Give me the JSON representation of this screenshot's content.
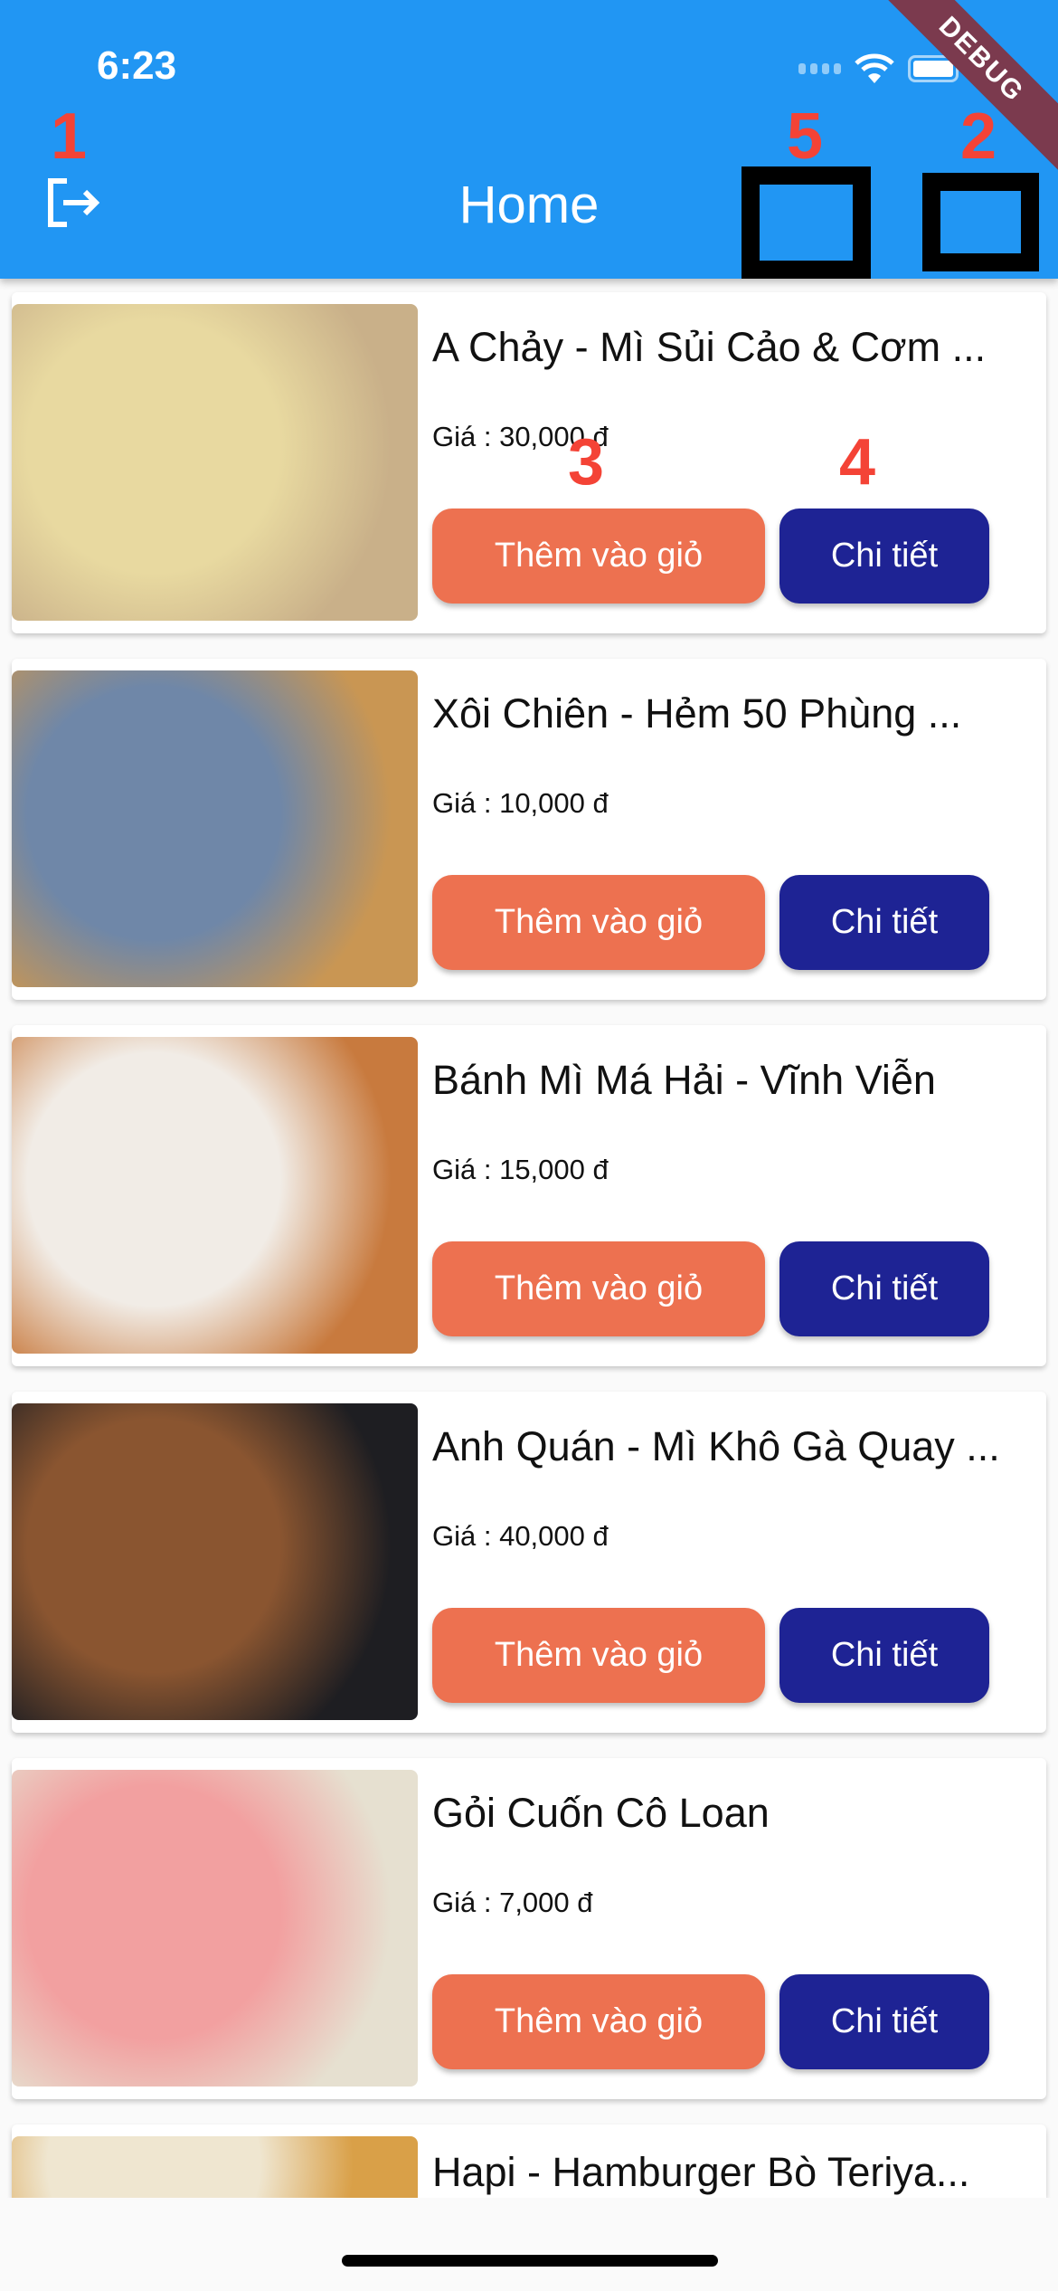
{
  "status": {
    "time": "6:23"
  },
  "appbar": {
    "title": "Home",
    "debug_banner": "DEBUG"
  },
  "annotations": [
    "1",
    "2",
    "3",
    "4",
    "5"
  ],
  "items": [
    {
      "name": "A Chảy - Mì Sủi Cảo & Cơm ...",
      "price": "Giá : 30,000 đ",
      "add_label": "Thêm vào giỏ",
      "detail_label": "Chi tiết",
      "c1": "#e8d9a0",
      "c2": "#c9b089"
    },
    {
      "name": "Xôi Chiên - Hẻm 50 Phùng ...",
      "price": "Giá : 10,000 đ",
      "add_label": "Thêm vào giỏ",
      "detail_label": "Chi tiết",
      "c1": "#6f87a8",
      "c2": "#c99653"
    },
    {
      "name": "Bánh Mì Má Hải - Vĩnh Viễn",
      "price": "Giá : 15,000 đ",
      "add_label": "Thêm vào giỏ",
      "detail_label": "Chi tiết",
      "c1": "#f1ece6",
      "c2": "#c87a3e"
    },
    {
      "name": "Anh Quán - Mì Khô Gà Quay ...",
      "price": "Giá : 40,000 đ",
      "add_label": "Thêm vào giỏ",
      "detail_label": "Chi tiết",
      "c1": "#8a5530",
      "c2": "#1e1e22"
    },
    {
      "name": "Gỏi Cuốn Cô Loan",
      "price": "Giá : 7,000 đ",
      "add_label": "Thêm vào giỏ",
      "detail_label": "Chi tiết",
      "c1": "#f2a0a0",
      "c2": "#e6e0d0"
    },
    {
      "name": "Hapi - Hamburger Bò Teriya...",
      "price": "",
      "add_label": "",
      "detail_label": "",
      "c1": "#efe6d0",
      "c2": "#d9a048"
    }
  ],
  "colors": {
    "primary": "#2196f3",
    "add": "#ed7150",
    "detail": "#1e2394"
  }
}
